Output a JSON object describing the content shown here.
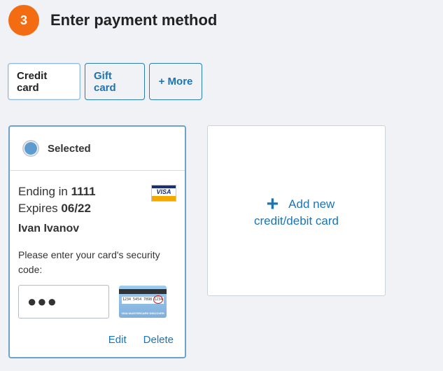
{
  "step": {
    "number": "3",
    "title": "Enter payment method"
  },
  "tabs": [
    {
      "label": "Credit card",
      "active": true
    },
    {
      "label": "Gift card",
      "active": false
    },
    {
      "label": "+ More",
      "active": false
    }
  ],
  "saved_card": {
    "status": "Selected",
    "ending_label": "Ending in",
    "ending_digits": "1111",
    "expires_label": "Expires",
    "expires_value": "06/22",
    "holder": "Ivan Ivanov",
    "brand_icon": "visa-icon",
    "brand_text": "VISA",
    "security_prompt": "Please enter your card's security code:",
    "security_value": "●●●",
    "cvv_help_icon": "card-back-cvv-icon",
    "cvv_help_number": "1234 5454 7898 1234",
    "cvv_help_code": "123",
    "cvv_help_brands": "VISA·MASTERCARD·DISCOVER",
    "edit_label": "Edit",
    "delete_label": "Delete"
  },
  "add_card": {
    "icon": "plus-icon",
    "line1": "Add new",
    "line2": "credit/debit card"
  },
  "colors": {
    "accent": "#1d74b4",
    "badge": "#f36c12",
    "radio": "#5e9bd0"
  }
}
